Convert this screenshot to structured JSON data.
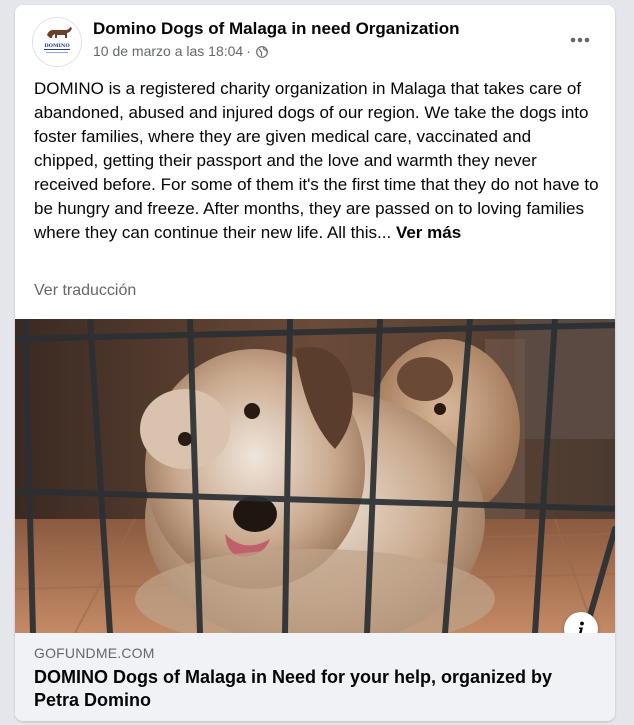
{
  "post": {
    "page_name": "Domino Dogs of Malaga in need Organization",
    "date": "10 de marzo a las 18:04",
    "separator": "·",
    "privacy_icon": "globe-icon",
    "more_icon": "more-horizontal-icon",
    "avatar_logo_text": "DOMINO",
    "body_text": "DOMINO is a registered charity organization in Malaga that takes care of abandoned, abused and injured dogs of our region. We take the dogs into foster families, where they are given medical care, vaccinated and chipped, getting their passport and the love and warmth they never received before. For some of them it's the first time that they do not have to be hungry and freeze. After months, they are passed on to loving families where they can continue their new life. All this...",
    "see_more_label": "Ver más",
    "translate_label": "Ver traducción"
  },
  "link": {
    "image_description_icon": "dog-behind-cage-photo",
    "info_icon": "info-icon",
    "domain": "GOFUNDME.COM",
    "title": "DOMINO Dogs of Malaga in Need for your help, organized by Petra Domino"
  },
  "colors": {
    "secondary_text": "#65676b",
    "primary_text": "#050505",
    "footer_bg": "#f0f2f5",
    "page_bg": "#e4e6eb"
  }
}
